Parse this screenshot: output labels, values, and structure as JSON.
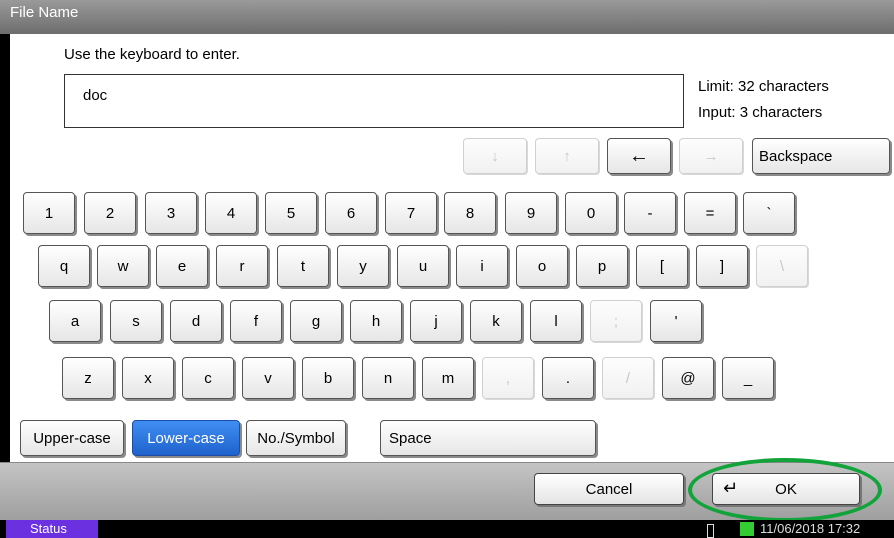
{
  "window": {
    "title": "File Name"
  },
  "prompt": "Use the keyboard to enter.",
  "input": {
    "value": "doc"
  },
  "limit_text": "Limit: 32 characters",
  "input_count_text": "Input: 3 characters",
  "nav": {
    "down": "↓",
    "up": "↑",
    "left": "←",
    "right": "→",
    "backspace": "Backspace"
  },
  "rows": {
    "row1": [
      "1",
      "2",
      "3",
      "4",
      "5",
      "6",
      "7",
      "8",
      "9",
      "0",
      "-",
      "=",
      "`"
    ],
    "row2": [
      "q",
      "w",
      "e",
      "r",
      "t",
      "y",
      "u",
      "i",
      "o",
      "p",
      "[",
      "]",
      "\\"
    ],
    "row3": [
      "a",
      "s",
      "d",
      "f",
      "g",
      "h",
      "j",
      "k",
      "l",
      ";",
      "'"
    ],
    "row4": [
      "z",
      "x",
      "c",
      "v",
      "b",
      "n",
      "m",
      ",",
      ".",
      "/",
      "@",
      "_"
    ]
  },
  "modes": {
    "upper": "Upper-case",
    "lower": "Lower-case",
    "symbol": "No./Symbol",
    "space": "Space"
  },
  "actions": {
    "cancel": "Cancel",
    "ok": "OK",
    "enter_symbol": "↵"
  },
  "status": {
    "tab": "Status",
    "datetime": "11/06/2018  17:32"
  },
  "colors": {
    "active_blue": "#2f74e6",
    "highlight_green": "#12a33a",
    "status_purple": "#6b31e0"
  }
}
